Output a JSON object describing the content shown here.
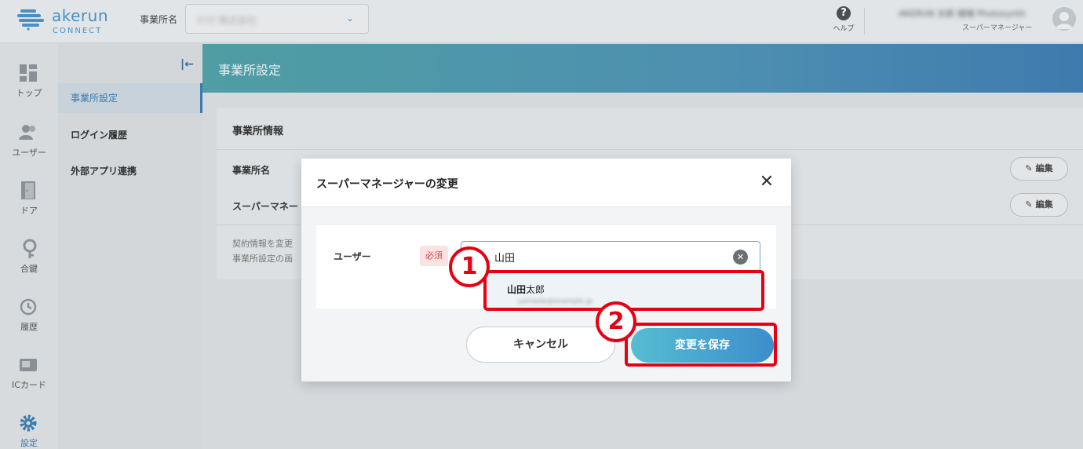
{
  "brand": {
    "name": "akerun",
    "sub": "CONNECT"
  },
  "header": {
    "office_label": "事業所名",
    "office_value": "XYZ 株式会社",
    "help_label": "ヘルプ",
    "user_name": "AKERUN 太郎 様様 Photosynth",
    "user_role": "スーパーマネージャー"
  },
  "nav": [
    {
      "icon": "top-icon",
      "label": "トップ"
    },
    {
      "icon": "users-icon",
      "label": "ユーザー"
    },
    {
      "icon": "door-icon",
      "label": "ドア"
    },
    {
      "icon": "key-icon",
      "label": "合鍵"
    },
    {
      "icon": "history-icon",
      "label": "履歴"
    },
    {
      "icon": "ic-card-icon",
      "label": "ICカード"
    },
    {
      "icon": "settings-icon",
      "label": "設定"
    }
  ],
  "sidemenu": {
    "items": [
      "事業所設定",
      "ログイン履歴",
      "外部アプリ連携"
    ],
    "active_index": 0
  },
  "page": {
    "title": "事業所設定",
    "section_title": "事業所情報",
    "rows": [
      {
        "label": "事業所名",
        "edit": "編集"
      },
      {
        "label": "スーパーマネー",
        "edit": "編集"
      }
    ],
    "note_line1": "契約情報を変更",
    "note_line2": "事業所設定の画"
  },
  "modal": {
    "title": "スーパーマネージャーの変更",
    "field_label": "ユーザー",
    "required": "必須",
    "input_value": "山田",
    "suggestion_bold": "山田",
    "suggestion_rest": "太郎",
    "suggestion_sub": "yamada@example.jp",
    "cancel": "キャンセル",
    "save": "変更を保存"
  },
  "annotations": {
    "badge1": "1",
    "badge2": "2",
    "color": "#e60012"
  }
}
